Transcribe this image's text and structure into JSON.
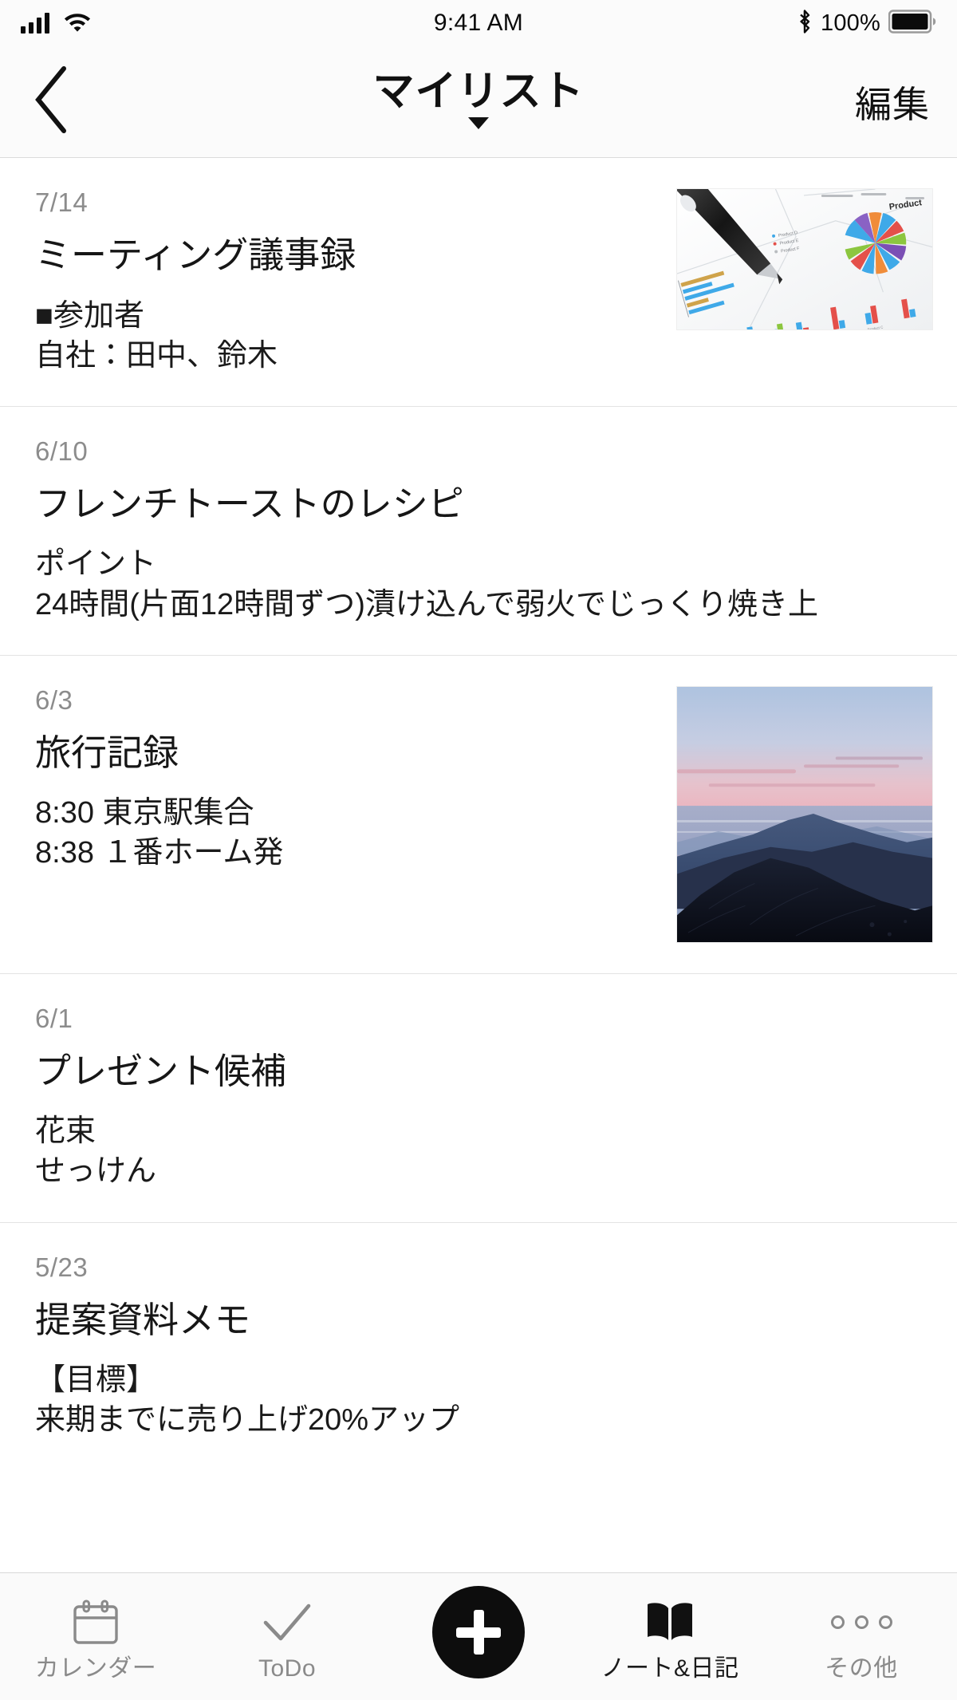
{
  "status_bar": {
    "signal_icon": "cellular-signal-icon",
    "wifi_icon": "wifi-icon",
    "time": "9:41 AM",
    "bluetooth_icon": "bluetooth-icon",
    "battery_percent": "100%",
    "battery_icon": "battery-full-icon"
  },
  "nav_bar": {
    "back_icon": "chevron-left-icon",
    "title": "マイリスト",
    "caret_icon": "caret-down-icon",
    "edit_label": "編集"
  },
  "notes": [
    {
      "date": "7/14",
      "title": "ミーティング議事録",
      "body": [
        "■参加者",
        "自社：田中、鈴木"
      ],
      "thumbnail": "business-charts-photo"
    },
    {
      "date": "6/10",
      "title": "フレンチトーストのレシピ",
      "body": [
        "ポイント",
        "24時間(片面12時間ずつ)漬け込んで弱火でじっくり焼き上"
      ],
      "thumbnail": null
    },
    {
      "date": "6/3",
      "title": "旅行記録",
      "body": [
        "8:30 東京駅集合",
        "8:38 １番ホーム発"
      ],
      "thumbnail": "mountain-sunset-photo"
    },
    {
      "date": "6/1",
      "title": "プレゼント候補",
      "body": [
        "花束",
        "せっけん"
      ],
      "thumbnail": null
    },
    {
      "date": "5/23",
      "title": "提案資料メモ",
      "body": [
        "【目標】",
        "来期までに売り上げ20%アップ"
      ],
      "thumbnail": null
    }
  ],
  "tab_bar": {
    "items": [
      {
        "label": "カレンダー",
        "icon": "calendar-icon",
        "active": false
      },
      {
        "label": "ToDo",
        "icon": "checkmark-icon",
        "active": false
      },
      {
        "label": "",
        "icon": "plus-icon",
        "active": false
      },
      {
        "label": "ノート&日記",
        "icon": "book-icon",
        "active": true
      },
      {
        "label": "その他",
        "icon": "ellipsis-icon",
        "active": false
      }
    ]
  },
  "colors": {
    "accent": "#0d0d0d",
    "date_text": "#8c8c8c",
    "body_text": "#1a1a1a",
    "inactive_tab": "#8a8a8a",
    "divider": "#e3e3e3",
    "bar_bg": "#fbfbfb"
  }
}
